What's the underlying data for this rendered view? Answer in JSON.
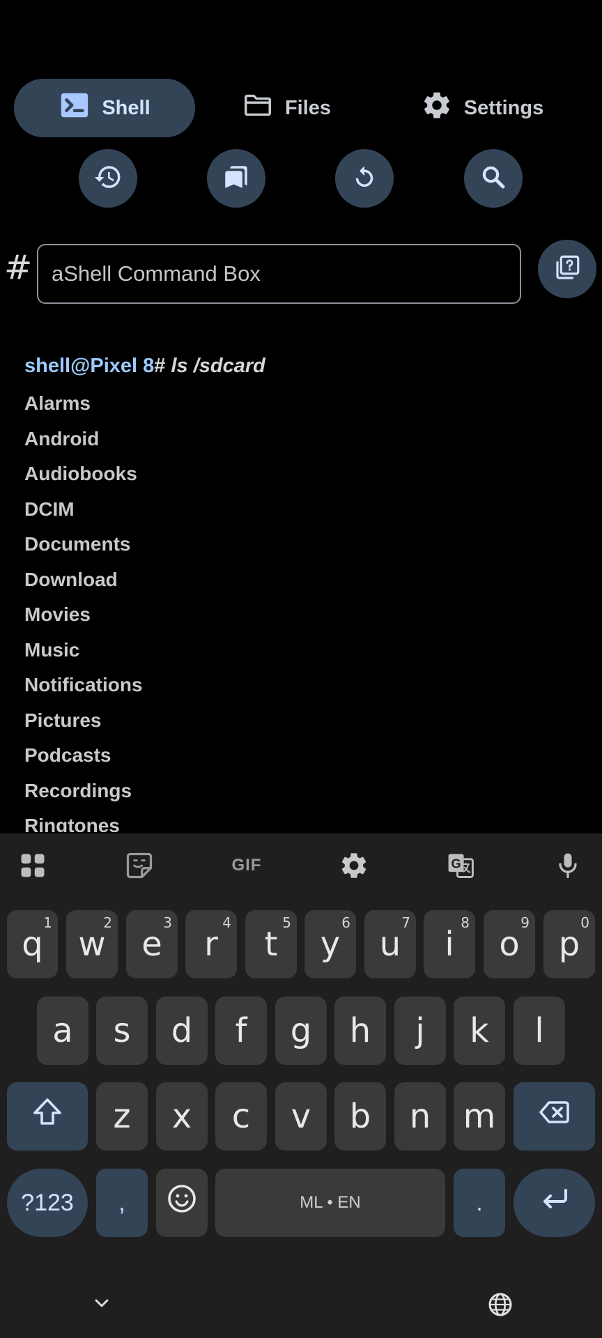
{
  "tabs": [
    {
      "label": "Shell",
      "icon": "terminal-icon",
      "active": true
    },
    {
      "label": "Files",
      "icon": "folder-icon",
      "active": false
    },
    {
      "label": "Settings",
      "icon": "gear-icon",
      "active": false
    }
  ],
  "actions": [
    "history-icon",
    "bookmarks-icon",
    "refresh-icon",
    "search-icon"
  ],
  "command": {
    "prompt_symbol": "#",
    "placeholder": "aShell Command Box",
    "help_icon": "command-help-icon"
  },
  "output": {
    "prompt_user": "shell@Pixel 8",
    "prompt_hash": "#",
    "command": " ls /sdcard",
    "lines": [
      "Alarms",
      "Android",
      "Audiobooks",
      "DCIM",
      "Documents",
      "Download",
      "Movies",
      "Music",
      "Notifications",
      "Pictures",
      "Podcasts",
      "Recordings",
      "Ringtones"
    ]
  },
  "keyboard": {
    "toolbar": [
      "apps-grid-icon",
      "sticker-icon",
      "GIF",
      "gear-icon",
      "translate-icon",
      "mic-icon"
    ],
    "row1": [
      {
        "key": "q",
        "hint": "1"
      },
      {
        "key": "w",
        "hint": "2"
      },
      {
        "key": "e",
        "hint": "3"
      },
      {
        "key": "r",
        "hint": "4"
      },
      {
        "key": "t",
        "hint": "5"
      },
      {
        "key": "y",
        "hint": "6"
      },
      {
        "key": "u",
        "hint": "7"
      },
      {
        "key": "i",
        "hint": "8"
      },
      {
        "key": "o",
        "hint": "9"
      },
      {
        "key": "p",
        "hint": "0"
      }
    ],
    "row2": [
      "a",
      "s",
      "d",
      "f",
      "g",
      "h",
      "j",
      "k",
      "l"
    ],
    "row3": [
      "z",
      "x",
      "c",
      "v",
      "b",
      "n",
      "m"
    ],
    "symbols_label": "?123",
    "comma": ",",
    "space_label": "ML • EN",
    "period": ".",
    "accent_color": "#344457"
  }
}
